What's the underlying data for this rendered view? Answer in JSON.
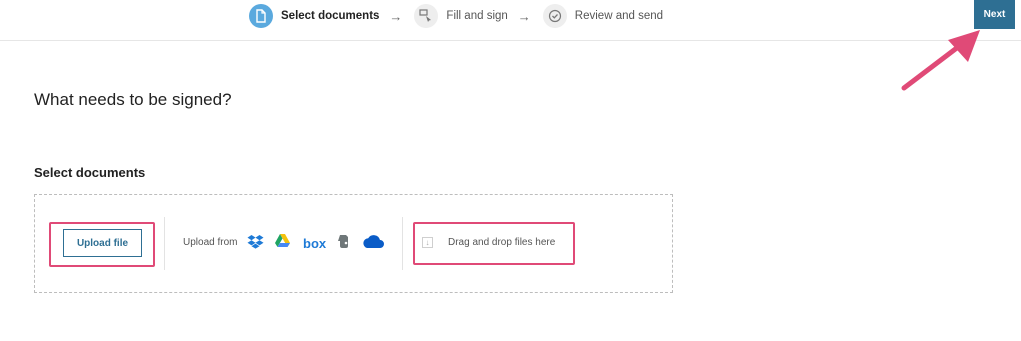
{
  "steps": [
    {
      "label": "Select documents",
      "icon": "document-icon",
      "active": true
    },
    {
      "label": "Fill and sign",
      "icon": "fill-sign-icon",
      "active": false
    },
    {
      "label": "Review and send",
      "icon": "check-circle-icon",
      "active": false
    }
  ],
  "header": {
    "next_label": "Next"
  },
  "main": {
    "heading": "What needs to be signed?",
    "section_title": "Select documents",
    "upload_button": "Upload file",
    "upload_from_label": "Upload from",
    "services": [
      "dropbox",
      "google-drive",
      "box",
      "evernote",
      "onedrive"
    ],
    "box_text": "box",
    "drag_drop_text": "Drag and drop files here"
  },
  "colors": {
    "accent": "#2e6f93",
    "active_step": "#5aa9de",
    "highlight": "#e04a77"
  }
}
